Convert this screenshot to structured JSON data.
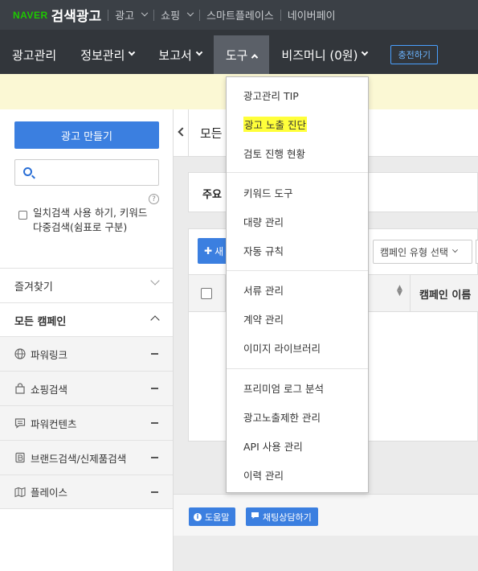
{
  "topbar": {
    "brand_naver": "NAVER",
    "brand_title": "검색광고",
    "links": [
      {
        "label": "광고",
        "has_dropdown": true
      },
      {
        "label": "쇼핑",
        "has_dropdown": true
      },
      {
        "label": "스마트플레이스",
        "has_dropdown": false
      },
      {
        "label": "네이버페이",
        "has_dropdown": false
      }
    ]
  },
  "mainnav": {
    "items": [
      {
        "label": "광고관리"
      },
      {
        "label": "정보관리"
      },
      {
        "label": "보고서"
      },
      {
        "label": "도구",
        "active": true
      },
      {
        "label": "비즈머니 (0원)"
      }
    ],
    "charge_label": "충전하기"
  },
  "sidebar": {
    "create_label": "광고 만들기",
    "search_placeholder": "",
    "help_glyph": "?",
    "exact_search_label": "일치검색 사용 하기, 키워드 다중검색(쉼표로 구분)",
    "favorites_label": "즐겨찾기",
    "all_campaigns_label": "모든 캠페인",
    "campaign_types": [
      {
        "label": "파워링크",
        "icon": "globe-icon"
      },
      {
        "label": "쇼핑검색",
        "icon": "shopping-bag-icon"
      },
      {
        "label": "파워컨텐츠",
        "icon": "chat-icon"
      },
      {
        "label": "브랜드검색/신제품검색",
        "icon": "brand-b-icon"
      },
      {
        "label": "플레이스",
        "icon": "map-icon"
      }
    ]
  },
  "main": {
    "page_title": "모든",
    "summary_label": "주요",
    "new_button_label": "새",
    "campaign_type_select": "캠페인 유형 선택",
    "column_campaign_name": "캠페인 이름",
    "help_button": "도움말",
    "chat_button": "채팅상담하기"
  },
  "dropdown": {
    "groups": [
      [
        "광고관리 TIP",
        "광고 노출 진단",
        "검토 진행 현황"
      ],
      [
        "키워드 도구",
        "대량 관리",
        "자동 규칙"
      ],
      [
        "서류 관리",
        "계약 관리",
        "이미지 라이브러리"
      ],
      [
        "프리미엄 로그 분석",
        "광고노출제한 관리",
        "API 사용 관리",
        "이력 관리"
      ]
    ],
    "highlighted": "광고 노출 진단"
  },
  "colors": {
    "topbar_bg": "#3b4046",
    "nav_bg": "#32363b",
    "nav_active_bg": "#5b6068",
    "accent_blue": "#3b7fe0",
    "naver_green": "#1ec800",
    "notice_bg": "#fbf8d4",
    "highlight": "#ffff3a"
  }
}
